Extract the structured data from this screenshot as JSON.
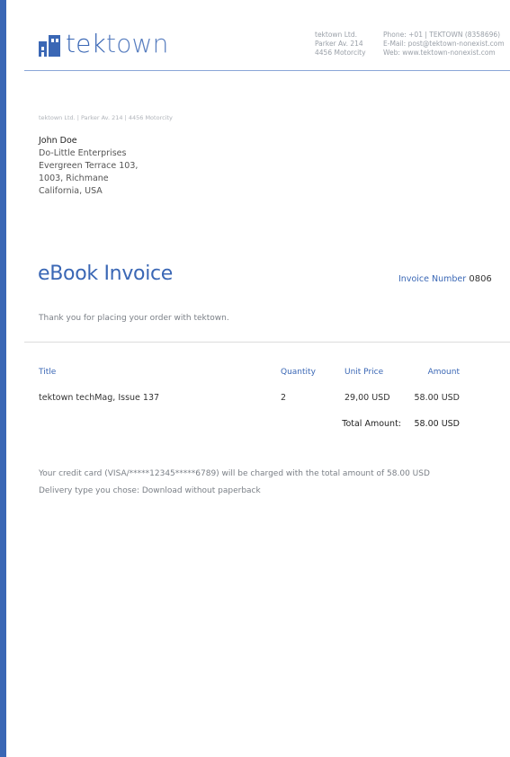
{
  "brand": {
    "part1": "tek",
    "part2": "town",
    "accent_color": "#3a67b5"
  },
  "header": {
    "address_lines": [
      "tektown Ltd.",
      "Parker Av. 214",
      "4456 Motorcity"
    ],
    "contact_lines": [
      "Phone: +01 | TEKTOWN (8358696)",
      "E-Mail: post@tektown-nonexist.com",
      "Web: www.tektown-nonexist.com"
    ]
  },
  "return_address": "tektown Ltd. | Parker Av. 214 | 4456 Motorcity",
  "recipient": {
    "name": "John Doe",
    "lines": [
      "Do-Little Enterprises",
      "Evergreen Terrace 103,",
      "1003, Richmane",
      "California, USA"
    ]
  },
  "invoice": {
    "title": "eBook Invoice",
    "number_label": "Invoice Number",
    "number": "0806",
    "thanks": "Thank you for placing your order with tektown."
  },
  "table": {
    "headers": {
      "title": "Title",
      "quantity": "Quantity",
      "unit_price": "Unit Price",
      "amount": "Amount"
    },
    "rows": [
      {
        "title": "tektown techMag, Issue 137",
        "quantity": "2",
        "unit_price": "29,00 USD",
        "amount": "58.00 USD"
      }
    ],
    "total_label": "Total Amount:",
    "total_value": "58.00 USD"
  },
  "notes": {
    "payment": "Your credit card (VISA/*****12345*****6789) will be charged with the total amount of 58.00 USD",
    "delivery": "Delivery type you chose: Download without paperback"
  }
}
